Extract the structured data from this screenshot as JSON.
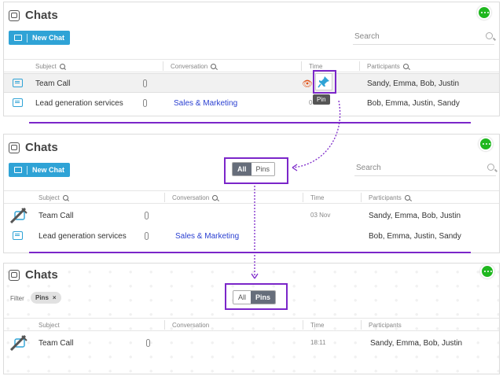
{
  "app_title": "Chats",
  "new_chat_label": "New Chat",
  "search_placeholder": "Search",
  "columns": {
    "subject": "Subject",
    "conversation": "Conversation",
    "time": "Time",
    "participants": "Participants"
  },
  "pin_tooltip": "Pin",
  "toggle": {
    "all": "All",
    "pins": "Pins"
  },
  "filter": {
    "label": "Filter",
    "chip": "Pins",
    "chip_close": "×"
  },
  "panel1_rows": [
    {
      "subject": "Team Call",
      "conversation": "",
      "time": "",
      "participants": "Sandy, Emma, Bob, Justin"
    },
    {
      "subject": "Lead generation services",
      "conversation": "Sales & Marketing",
      "time": "0",
      "participants": "Bob, Emma, Justin, Sandy"
    }
  ],
  "panel2_rows": [
    {
      "subject": "Team Call",
      "conversation": "",
      "time": "03 Nov",
      "participants": "Sandy, Emma, Bob, Justin"
    },
    {
      "subject": "Lead generation services",
      "conversation": "Sales & Marketing",
      "time": "03 Nov",
      "participants": "Bob, Emma, Justin, Sandy"
    }
  ],
  "panel3_rows": [
    {
      "subject": "Team Call",
      "conversation": "",
      "time": "18:11",
      "participants": "Sandy, Emma, Bob, Justin"
    }
  ],
  "colors": {
    "accent": "#2fa3d6",
    "highlight": "#7b26c9",
    "link": "#2a3fd1",
    "badge": "#1fb71f"
  },
  "icons": [
    "chats-logo-icon",
    "chat-bubble-icon",
    "search-icon",
    "paperclip-icon",
    "pin-icon",
    "eye-icon",
    "pinned-chat-icon",
    "close-icon",
    "messages-badge-icon"
  ]
}
